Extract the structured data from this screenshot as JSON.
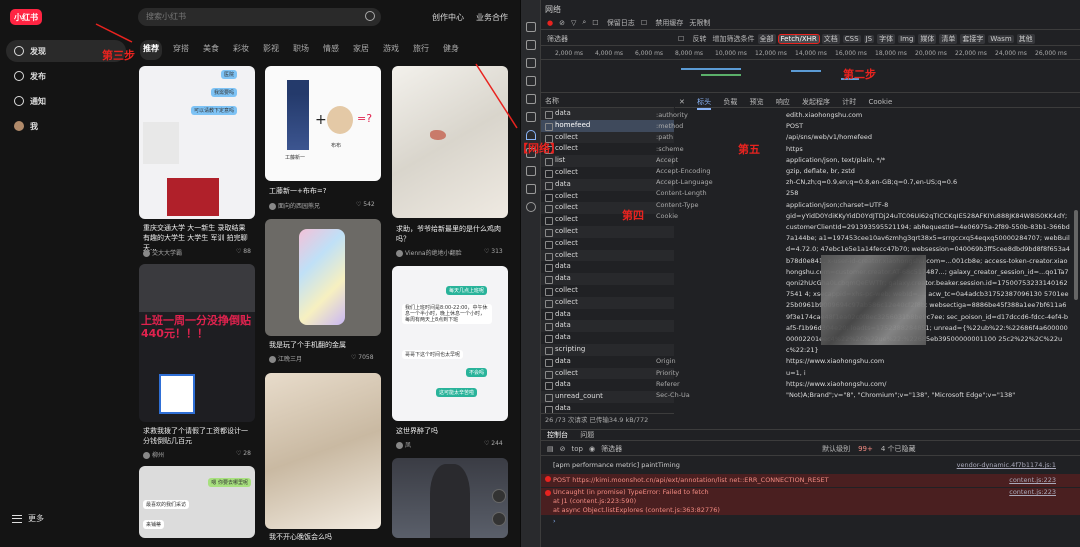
{
  "xhs": {
    "logo": "小红书",
    "search_placeholder": "搜索小红书",
    "nav_creator": "创作中心",
    "nav_business": "业务合作",
    "sidebar": [
      "发现",
      "发布",
      "通知",
      "我"
    ],
    "more": "更多",
    "channels": [
      "推荐",
      "穿搭",
      "美食",
      "彩妆",
      "影视",
      "职场",
      "情感",
      "家居",
      "游戏",
      "旅行",
      "健身"
    ],
    "cards": [
      {
        "title": "重庆交通大学 大一新生 录取结果 有趣的大学生 大学生 军训 拍完聊天...",
        "author": "交大大学霸",
        "likes": "88"
      },
      {
        "title": "工藤新一+布布=?",
        "author": "面向的西园熊兄",
        "likes": "542"
      },
      {
        "title": "求助，爷爷给新最里的是什么鸡肉吗？",
        "author": "Vienna的绝地小翻脸",
        "likes": "313"
      },
      {
        "title": "上班一周一分没挣倒贴440元！！！",
        "author": "",
        "likes": ""
      },
      {
        "title": "我是玩了个手机翻的金属",
        "author": "江晚三月",
        "likes": "7058"
      },
      {
        "title": "求救我拨了个请假了工资都设计一分钱倒贴几百元",
        "author": "柳州",
        "likes": "28"
      },
      {
        "title": "这世界醉了吗",
        "author": "凤",
        "likes": "244"
      },
      {
        "title": "我不开心晚饭会么吗",
        "author": "",
        "likes": ""
      }
    ],
    "img1_text": "工藤新一",
    "img1_text2": "布布",
    "bubble_top": "医院",
    "bubble_home": "我需要吗",
    "bubble_blue": "可以请教下定意吗",
    "chat_bubbles": [
      "每天几点上班呢",
      "我们上班时间是8:00-22:00，中午休息一个半小时，晚上休息一个小时，每周有两天上8点到下班",
      "哥哥下这个时间也太早呢",
      "不会吗",
      "这可能太辛苦啦"
    ],
    "bottom_bubbles": [
      "嗯 你要去哪里呢",
      "最喜欢的我们采访",
      "来铺蒂"
    ]
  },
  "annotations": {
    "step1": "第一步，选择【网络】",
    "step2": "第二步",
    "step3": "第三步",
    "step4": "第四",
    "step5": "第五"
  },
  "devtools": {
    "panel_title": "网络",
    "toolbar1": [
      "保留日志",
      "禁用缓存",
      "无限制"
    ],
    "filter_placeholder": "筛选器",
    "filter_invert": "反转",
    "filter_more": "增加筛选条件",
    "type_buttons": [
      "全部",
      "Fetch/XHR",
      "文档",
      "CSS",
      "JS",
      "字体",
      "Img",
      "媒体",
      "清单",
      "套接字",
      "Wasm",
      "其他"
    ],
    "ticks": [
      "2,000 ms",
      "4,000 ms",
      "6,000 ms",
      "8,000 ms",
      "10,000 ms",
      "12,000 ms",
      "14,000 ms",
      "16,000 ms",
      "18,000 ms",
      "20,000 ms",
      "22,000 ms",
      "24,000 ms",
      "26,000 ms"
    ],
    "name_header": "名称",
    "requests": [
      "data",
      "homefeed",
      "collect",
      "collect",
      "list",
      "collect",
      "data",
      "collect",
      "collect",
      "collect",
      "collect",
      "collect",
      "collect",
      "data",
      "data",
      "collect",
      "collect",
      "data",
      "data",
      "data",
      "scripting",
      "data",
      "collect",
      "data",
      "unread_count",
      "data"
    ],
    "status": "26 /73 次请求  已传输34.9 kB/772",
    "tabs": [
      "标头",
      "负载",
      "预览",
      "响应",
      "发起程序",
      "计时",
      "Cookie"
    ],
    "headers": [
      [
        ":authority",
        "edith.xiaohongshu.com"
      ],
      [
        ":method",
        "POST"
      ],
      [
        ":path",
        "/api/sns/web/v1/homefeed"
      ],
      [
        ":scheme",
        "https"
      ],
      [
        "Accept",
        "application/json, text/plain, */*"
      ],
      [
        "Accept-Encoding",
        "gzip, deflate, br, zstd"
      ],
      [
        "Accept-Language",
        "zh-CN,zh;q=0.9,en;q=0.8,en-GB;q=0.7,en-US;q=0.6"
      ],
      [
        "Content-Length",
        "258"
      ],
      [
        "Content-Type",
        "application/json;charset=UTF-8"
      ],
      [
        "Cookie",
        "gid=yYidD0YdiKKyYidD0YdJTDj24uTC06Ui62qTICCKqIE528AFKIYu888JK84W8iS0KK4dY; customerClientId=291393595521194; abRequestId=4e06975a-2f89-550b-83b1-366bd7a144be; a1=197453cee10av6zmhg3qrt38x5=srrgccxq54eqxq50000284707; webBuild=4.72.0; 47ebc1e5e1a14fecc47b70; websession=040069b3ff5cee8dbd9bd8f8f653a4b78d0e841; x-user-id-creator.xiaohongshu.com=...001cb8e; access-token-creator.xiaohongshu.com=customer.creator.AT-68c517487...; galaxy_creator_session_id=...qo1Ta7qoni2hUcGha0LcbqmQeEWTfr; galaxy.creator.beaker.session.id=175007532331401627541 4; xsecappid=xhs-pc-web; webId=...; acw_tc=0a4adcb31752387096130 5701ee25b0961b9009694c97ab586c12e40cf2f8b; websectiga=8886be45f388a1ee7bf611a69f3e174cae48f1ea02c0f8ec3256031b8be9c7ee; sec_poison_id=d17dccd6-fdcc-4ef4-baf5-f1b96d304e20; loadts=1752388284851; unread={%22ub%22:%22686f4a60000000002201eec4%22%2C%22ue%22:%22685eb39500000001100 25c2%22%2C%22uc%22:21}"
      ],
      [
        "Origin",
        "https://www.xiaohongshu.com"
      ],
      [
        "Priority",
        "u=1, i"
      ],
      [
        "Referer",
        "https://www.xiaohongshu.com/"
      ],
      [
        "Sec-Ch-Ua",
        "\"Not)A;Brand\";v=\"8\", \"Chromium\";v=\"138\", \"Microsoft Edge\";v=\"138\""
      ]
    ],
    "console_tabs": [
      "控制台",
      "问题"
    ],
    "console_context": "top",
    "console_filter": "筛选器",
    "console_level": "默认级别",
    "console_count": "99+",
    "console_hidden": "4 个已隐藏",
    "console_lines": [
      {
        "text": "[apm performance metric] paintTiming",
        "src": "vendor-dynamic.4f7b1174.js:1",
        "err": false
      },
      {
        "text": "POST https://kimi.moonshot.cn/api/ext/annotation/list net::ERR_CONNECTION_RESET",
        "src": "content.js:223",
        "err": true
      },
      {
        "text": "Uncaught (in promise) TypeError: Failed to fetch",
        "src": "content.js:223",
        "err": true
      },
      {
        "text": "    at J1 (content.js:223:590)",
        "src": "",
        "err": true
      },
      {
        "text": "    at async Object.listExplores (content.js:363:82776)",
        "src": "",
        "err": true
      }
    ]
  },
  "colors": {
    "brand": "#ff2442",
    "annotation": "#e8231f",
    "accent": "#8ab4f8"
  }
}
